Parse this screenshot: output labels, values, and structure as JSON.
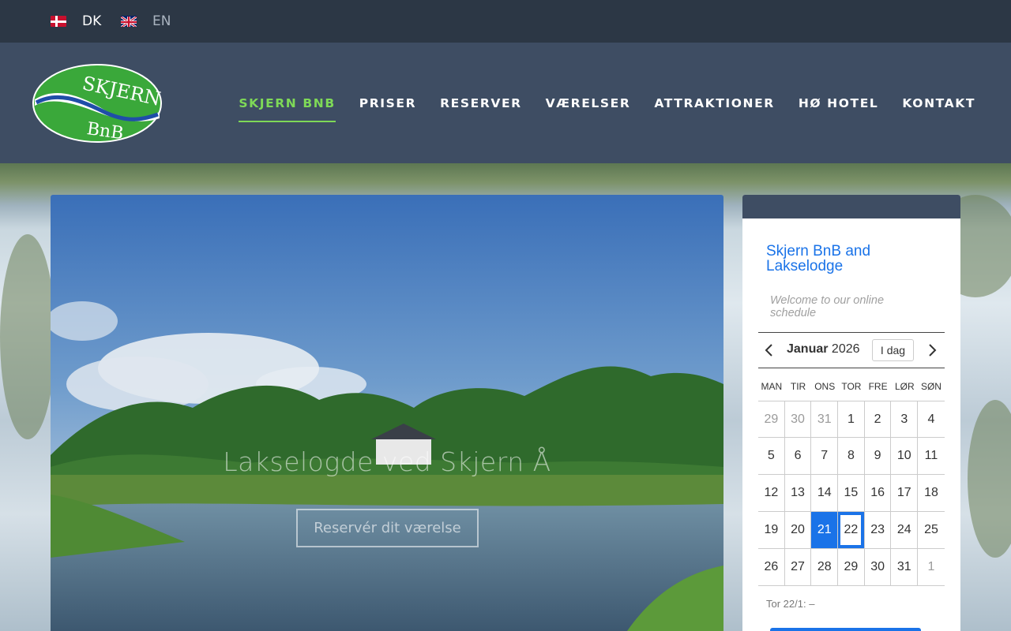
{
  "languages": [
    {
      "code": "DK",
      "active": true
    },
    {
      "code": "EN",
      "active": false
    }
  ],
  "logo": {
    "line1": "SKJERN",
    "line2": "BnB"
  },
  "nav": {
    "items": [
      {
        "label": "SKJERN BNB",
        "active": true
      },
      {
        "label": "PRISER"
      },
      {
        "label": "RESERVER"
      },
      {
        "label": "VÆRELSER"
      },
      {
        "label": "ATTRAKTIONER"
      },
      {
        "label": "HØ HOTEL"
      },
      {
        "label": "KONTAKT"
      }
    ]
  },
  "hero": {
    "headline": "Lakselogde ved Skjern Å",
    "button": "Reservér dit værelse"
  },
  "widget": {
    "title": "Skjern BnB and Lakselodge",
    "subtitle": "Welcome to our online schedule",
    "month": "Januar",
    "year": "2026",
    "today_label": "I dag",
    "weekdays": [
      "MAN",
      "TIR",
      "ONS",
      "TOR",
      "FRE",
      "LØR",
      "SØN"
    ],
    "weeks": [
      [
        "29",
        "30",
        "31",
        "1",
        "2",
        "3",
        "4"
      ],
      [
        "5",
        "6",
        "7",
        "8",
        "9",
        "10",
        "11"
      ],
      [
        "12",
        "13",
        "14",
        "15",
        "16",
        "17",
        "18"
      ],
      [
        "19",
        "20",
        "21",
        "22",
        "23",
        "24",
        "25"
      ],
      [
        "26",
        "27",
        "28",
        "29",
        "30",
        "31",
        "1"
      ]
    ],
    "selected_day": "21",
    "today_day": "22",
    "info": "Tor 22/1: –"
  },
  "colors": {
    "topbar": "#2c3745",
    "header": "#3e4d63",
    "accent_green": "#7ed957",
    "accent_blue": "#1a73e8"
  }
}
